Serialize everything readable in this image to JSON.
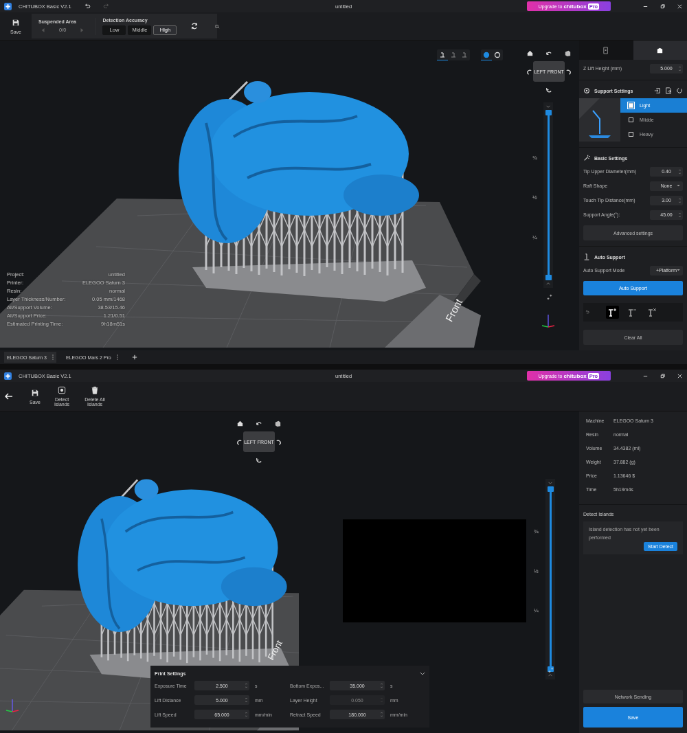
{
  "edit_window": {
    "title_bar": {
      "app_name": "CHITUBOX Basic V2.1",
      "document": "untitled",
      "upgrade_label": "Upgrade to",
      "upgrade_brand": "chitubox",
      "upgrade_badge": "Pro"
    },
    "toolbar": {
      "save": "Save",
      "suspended_area": {
        "title": "Suspended Area",
        "value": "0/0"
      },
      "detection_accuracy": {
        "title": "Detection Accuracy",
        "options": [
          {
            "label": "Low",
            "selected": false
          },
          {
            "label": "Middle",
            "selected": false
          },
          {
            "label": "High",
            "selected": true
          }
        ]
      }
    },
    "view_modes": [
      {
        "selected": true
      },
      {
        "selected": false
      },
      {
        "selected": false
      }
    ],
    "render_modes": [
      {
        "selected": true
      },
      {
        "selected": false
      }
    ],
    "nav_cube": {
      "left_face": "LEFT",
      "front_face": "FRONT"
    },
    "layer_slider": {
      "marks": [
        "¾",
        "½",
        "¼"
      ],
      "level": 1
    },
    "platform_label": "Front",
    "model_info": [
      {
        "label": "Project:",
        "value": "untitled"
      },
      {
        "label": "Printer:",
        "value": "ELEGOO Saturn 3"
      },
      {
        "label": "Resin:",
        "value": "normal"
      },
      {
        "label": "Layer Thickness/Number:",
        "value": "0.05 mm/1468"
      },
      {
        "label": "All/Support Volume:",
        "value": "38.53/15.46"
      },
      {
        "label": "All/Support Price:",
        "value": "1.21/0.51"
      },
      {
        "label": "Estimated Printing Time:",
        "value": "9h18m51s"
      }
    ],
    "printer_tabs": [
      {
        "label": "ELEGOO Saturn 3",
        "selected": true
      },
      {
        "label": "ELEGOO Mars 2 Pro",
        "selected": false
      }
    ],
    "panel": {
      "tabs": [
        {
          "selected": false
        },
        {
          "selected": true
        }
      ],
      "z_lift": {
        "label": "Z Lift Height (mm)",
        "value": "5.000"
      },
      "support_settings": {
        "title": "Support Settings",
        "presets": [
          {
            "label": "Light",
            "selected": true
          },
          {
            "label": "Miidde",
            "selected": false
          },
          {
            "label": "Heavy",
            "selected": false
          }
        ]
      },
      "basic_settings": {
        "title": "Basic Settings",
        "fields": [
          {
            "label": "Tip Upper Diameter(mm)",
            "value": "0.40",
            "kind": "spin"
          },
          {
            "label": "Raft Shape",
            "value": "None",
            "kind": "select"
          },
          {
            "label": "Touch Tip Distance(mm)",
            "value": "3.00",
            "kind": "spin"
          },
          {
            "label": "Support Angle(°):",
            "value": "45.00",
            "kind": "spin"
          }
        ]
      },
      "advanced_button": "Advanced settings",
      "auto_support": {
        "title": "Auto Support",
        "mode_label": "Auto Support Mode",
        "mode_value": "+Platform",
        "button": "Auto Support"
      },
      "support_tools": [
        {
          "selected": true
        },
        {
          "selected": false
        },
        {
          "selected": false
        }
      ],
      "clear_button": "Clear All"
    }
  },
  "preview_window": {
    "title_bar": {
      "app_name": "CHITUBOX Basic V2.1",
      "document": "untitled",
      "upgrade_label": "Upgrade to",
      "upgrade_brand": "chitubox",
      "upgrade_badge": "Pro"
    },
    "toolbar": [
      {
        "label": "Save",
        "kind": "save"
      },
      {
        "label": "Detect Islands",
        "kind": "detect"
      },
      {
        "label": "Delete All Islands",
        "kind": "delete"
      }
    ],
    "nav_cube": {
      "left_face": "LEFT",
      "front_face": "FRONT"
    },
    "platform_label": "Front",
    "layer_slider": {
      "marks": [
        "¾",
        "½",
        "¼"
      ],
      "level": 1
    },
    "print_settings": {
      "title": "Print Settings",
      "fields": [
        {
          "label": "Exposure Time",
          "value": "2.500",
          "unit": "s",
          "disabled": false
        },
        {
          "label": "Bottom Expos...",
          "value": "35.000",
          "unit": "s",
          "disabled": false
        },
        {
          "label": "Lift Distance",
          "value": "5.000",
          "unit": "mm",
          "disabled": false
        },
        {
          "label": "Layer Height",
          "value": "0.050",
          "unit": "mm",
          "disabled": true
        },
        {
          "label": "Lift Speed",
          "value": "65.000",
          "unit": "mm/min",
          "disabled": false
        },
        {
          "label": "Retract Speed",
          "value": "180.000",
          "unit": "mm/min",
          "disabled": false
        }
      ]
    },
    "summary": [
      {
        "label": "Machine",
        "value": "ELEGOO Saturn 3"
      },
      {
        "label": "Resin",
        "value": "normal"
      },
      {
        "label": "Volume",
        "value": "34.4382 (ml)"
      },
      {
        "label": "Weight",
        "value": "37.882 (g)"
      },
      {
        "label": "Price",
        "value": "1.13646 $"
      },
      {
        "label": "Time",
        "value": "5h19m4s"
      }
    ],
    "detect_islands": {
      "title": "Detect Islands",
      "message": "Island detection has not yet been performed",
      "button": "Start Detect"
    },
    "network_button": "Network Sending",
    "save_button": "Save"
  }
}
